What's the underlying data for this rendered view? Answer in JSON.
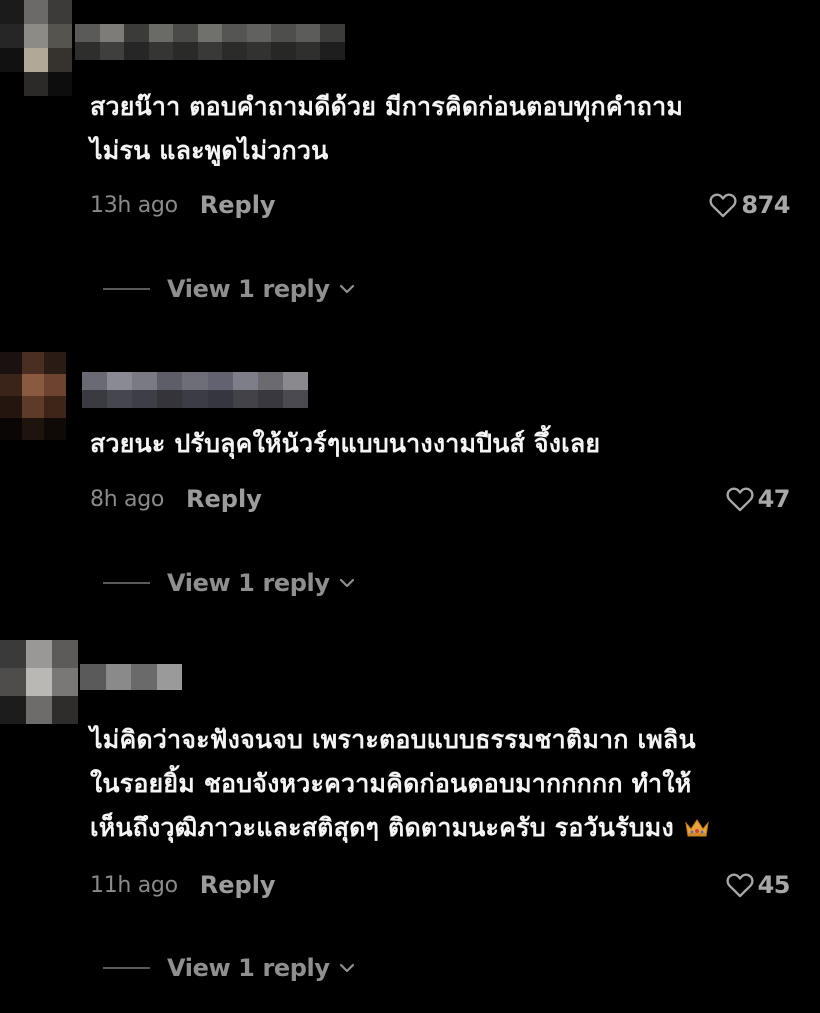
{
  "comments": [
    {
      "text_lines": [
        "สวยน๊าา ตอบคำถามดีด้วย มีการคิดก่อนตอบทุกคำถาม",
        "ไม่รน และพูดไม่วกวน"
      ],
      "time": "13h ago",
      "reply_label": "Reply",
      "likes": "874",
      "view_replies_label": "View 1 reply"
    },
    {
      "text_lines": [
        "สวยนะ ปรับลุคให้นัวร์ๆแบบนางงามปีนส์ จึ้งเลย"
      ],
      "time": "8h ago",
      "reply_label": "Reply",
      "likes": "47",
      "view_replies_label": "View 1 reply"
    },
    {
      "text_lines": [
        "ไม่คิดว่าจะฟังจนจบ เพราะตอบแบบธรรมชาติมาก เพลิน",
        "ในรอยยิ้ม ชอบจังหวะความคิดก่อนตอบมากกกกก ทำให้",
        "เห็นถึงวุฒิภาวะและสติสุดๆ ติดตามนะครับ รอวันรับมง"
      ],
      "emoji": "crown-icon",
      "time": "11h ago",
      "reply_label": "Reply",
      "likes": "45",
      "view_replies_label": "View 1 reply"
    }
  ],
  "colors": {
    "background": "#000000",
    "text": "#f4f4f4",
    "muted": "#8a8a8a",
    "reply": "#9c9c9c"
  }
}
